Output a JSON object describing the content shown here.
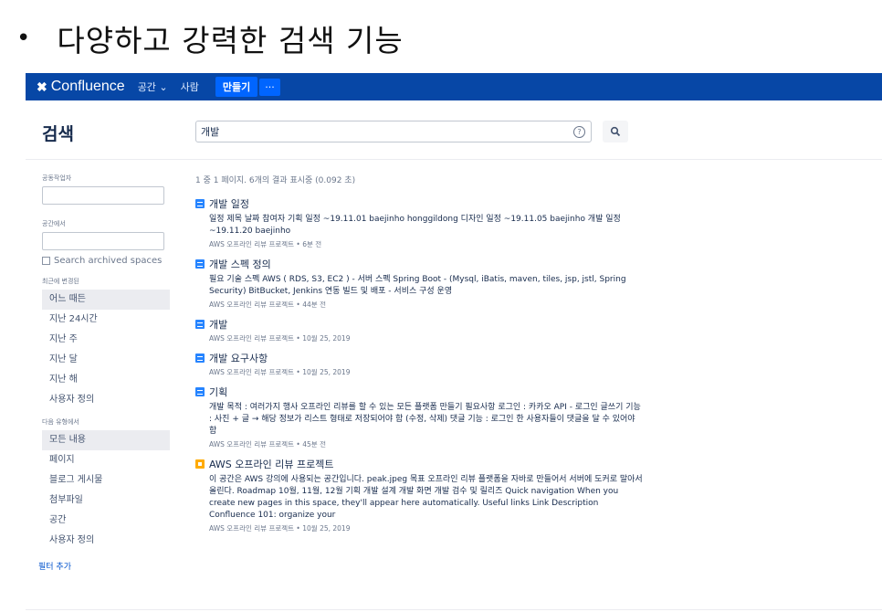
{
  "slide": {
    "bullet": "•",
    "title": "다양하고 강력한 검색 기능"
  },
  "topbar": {
    "logo_icon": "✖",
    "logo_text": "Confluence",
    "nav": [
      "공간 ⌄",
      "사람"
    ],
    "create_label": "만들기",
    "more_label": "···"
  },
  "search": {
    "heading": "검색",
    "query": "개발",
    "help_icon": "?"
  },
  "sidebar": {
    "contributor_label": "공동작업자",
    "space_label": "공간에서",
    "archived_label": "Search archived spaces",
    "modified_label": "최근에 변경된",
    "modified_options": [
      "어느 때든",
      "지난 24시간",
      "지난 주",
      "지난 달",
      "지난 해",
      "사용자 정의"
    ],
    "type_label": "다음 유형에서",
    "type_options": [
      "모든 내용",
      "페이지",
      "블로그 게시물",
      "첨부파일",
      "공간",
      "사용자 정의"
    ],
    "add_filter": "필터 추가"
  },
  "results": {
    "count": "1 중 1 페이지. 6개의 결과 표시중 (0.092 초)",
    "items": [
      {
        "type": "page",
        "title": "개발 일정",
        "snippet": "일정 제목 날짜 참여자 기획 일정 ~19.11.01 baejinho honggildong 디자인 일정 ~19.11.05 baejinho 개발 일정 ~19.11.20 baejinho",
        "meta": "AWS 오프라인 리뷰 프로젝트 • 6분 전"
      },
      {
        "type": "page",
        "title": "개발 스펙 정의",
        "snippet": "필요 기술 스펙 AWS ( RDS, S3, EC2 ) - 서버 스펙 Spring Boot - (Mysql, iBatis, maven, tiles, jsp, jstl, Spring Security) BitBucket, Jenkins 연동 빌드 및 배포 - 서비스 구성 운영",
        "meta": "AWS 오프라인 리뷰 프로젝트 • 44분 전"
      },
      {
        "type": "page",
        "title": "개발",
        "snippet": "",
        "meta": "AWS 오프라인 리뷰 프로젝트 • 10월 25, 2019"
      },
      {
        "type": "page",
        "title": "개발 요구사항",
        "snippet": "",
        "meta": "AWS 오프라인 리뷰 프로젝트 • 10월 25, 2019"
      },
      {
        "type": "page",
        "title": "기획",
        "snippet": "개발 목적 : 여러가지 행사 오프라인 리뷰를 할 수 있는 모든 플랫폼 만들기 필요사항 로그인 : 카카오 API - 로그인 글쓰기 기능 : 사진 + 글 → 해당 정보가 리스트 형태로 저장되어야 함 (수정, 삭제) 댓글 기능 : 로그인 한 사용자들이 댓글을 달 수 있어야 함",
        "meta": "AWS 오프라인 리뷰 프로젝트 • 45분 전"
      },
      {
        "type": "space",
        "title": "AWS 오프라인 리뷰 프로젝트",
        "snippet": "이 공간은 AWS 강의에 사용되는 공간입니다. peak.jpeg 목표 오프라인 리뷰 플랫폼을 자바로 만들어서 서버에 도커로 말아서 올린다. Roadmap 10월, 11월, 12월 기획 개발 설계 개발 화면 개발 검수 및 릴리즈 Quick navigation When you create new pages in this space, they'll appear here automatically. Useful links Link Description Confluence 101: organize your",
        "meta": "AWS 오프라인 리뷰 프로젝트 • 10월 25, 2019"
      }
    ]
  }
}
